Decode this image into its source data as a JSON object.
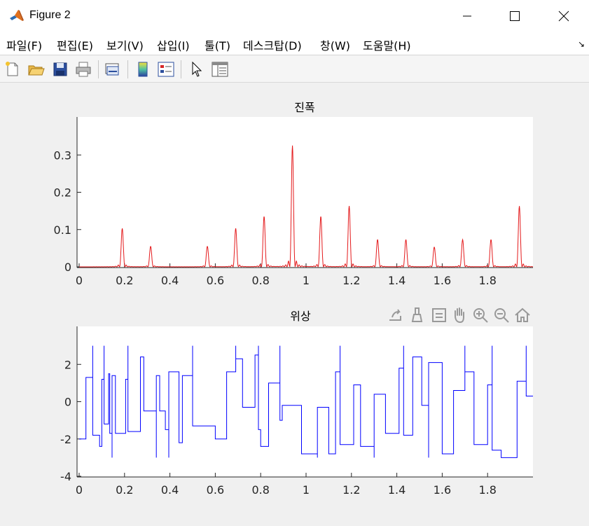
{
  "window": {
    "title": "Figure 2"
  },
  "menu": [
    "파일(F)",
    "편집(E)",
    "보기(V)",
    "삽입(I)",
    "툴(T)",
    "데스크탑(D)",
    "창(W)",
    "도움말(H)"
  ],
  "toolbar_icons": [
    "new-figure-icon",
    "open-file-icon",
    "save-icon",
    "print-icon",
    "link-plot-icon",
    "colorbar-icon",
    "legend-icon",
    "pointer-icon",
    "property-inspector-icon"
  ],
  "axes_toolbar_icons": [
    "export-icon",
    "brush-icon",
    "data-tip-icon",
    "pan-icon",
    "zoom-in-icon",
    "zoom-out-icon",
    "home-icon"
  ],
  "chart_data": [
    {
      "type": "line",
      "title": "진폭",
      "xlabel": "",
      "ylabel": "",
      "xlim": [
        0,
        2
      ],
      "ylim": [
        0,
        0.4
      ],
      "xticks": [
        0,
        0.2,
        0.4,
        0.6,
        0.8,
        1,
        1.2,
        1.4,
        1.6,
        1.8
      ],
      "xtick_labels": [
        "0",
        "0.2",
        "0.4",
        "0.6",
        "0.8",
        "1",
        "1.2",
        "1.4",
        "1.6",
        "1.8"
      ],
      "yticks": [
        0,
        0.1,
        0.2,
        0.3
      ],
      "ytick_labels": [
        "0",
        "0.1",
        "0.2",
        "0.3"
      ],
      "color": "#e41a1c",
      "peaks": [
        {
          "x": 0.19,
          "y": 0.103
        },
        {
          "x": 0.315,
          "y": 0.055
        },
        {
          "x": 0.565,
          "y": 0.055
        },
        {
          "x": 0.69,
          "y": 0.103
        },
        {
          "x": 0.815,
          "y": 0.135
        },
        {
          "x": 0.94,
          "y": 0.325
        },
        {
          "x": 1.065,
          "y": 0.135
        },
        {
          "x": 1.19,
          "y": 0.163
        },
        {
          "x": 1.315,
          "y": 0.073
        },
        {
          "x": 1.44,
          "y": 0.073
        },
        {
          "x": 1.565,
          "y": 0.053
        },
        {
          "x": 1.69,
          "y": 0.073
        },
        {
          "x": 1.815,
          "y": 0.073
        },
        {
          "x": 1.94,
          "y": 0.163
        }
      ]
    },
    {
      "type": "line",
      "title": "위상",
      "xlabel": "",
      "ylabel": "",
      "xlim": [
        0,
        2
      ],
      "ylim": [
        -4,
        4
      ],
      "xticks": [
        0,
        0.2,
        0.4,
        0.6,
        0.8,
        1,
        1.2,
        1.4,
        1.6,
        1.8
      ],
      "xtick_labels": [
        "0",
        "0.2",
        "0.4",
        "0.6",
        "0.8",
        "1",
        "1.2",
        "1.4",
        "1.6",
        "1.8"
      ],
      "yticks": [
        -4,
        -2,
        0,
        2
      ],
      "ytick_labels": [
        "-4",
        "-2",
        "0",
        "2"
      ],
      "color": "#0000ff",
      "levels": [
        {
          "x0": 0.0,
          "x1": 0.03,
          "y": -2.0
        },
        {
          "x0": 0.03,
          "x1": 0.06,
          "y": 1.3
        },
        {
          "x0": 0.06,
          "x1": 0.09,
          "y": -1.8
        },
        {
          "x0": 0.09,
          "x1": 0.1,
          "y": -2.4
        },
        {
          "x0": 0.1,
          "x1": 0.11,
          "y": 1.2
        },
        {
          "x0": 0.11,
          "x1": 0.13,
          "y": -1.2
        },
        {
          "x0": 0.13,
          "x1": 0.135,
          "y": 1.5
        },
        {
          "x0": 0.135,
          "x1": 0.145,
          "y": -1.7
        },
        {
          "x0": 0.145,
          "x1": 0.16,
          "y": 1.4
        },
        {
          "x0": 0.16,
          "x1": 0.205,
          "y": -1.7
        },
        {
          "x0": 0.205,
          "x1": 0.215,
          "y": 1.2
        },
        {
          "x0": 0.215,
          "x1": 0.27,
          "y": -1.6
        },
        {
          "x0": 0.27,
          "x1": 0.285,
          "y": 2.4
        },
        {
          "x0": 0.285,
          "x1": 0.34,
          "y": -0.5
        },
        {
          "x0": 0.34,
          "x1": 0.355,
          "y": 1.4
        },
        {
          "x0": 0.355,
          "x1": 0.38,
          "y": -0.5
        },
        {
          "x0": 0.38,
          "x1": 0.395,
          "y": -1.5
        },
        {
          "x0": 0.395,
          "x1": 0.44,
          "y": 1.6
        },
        {
          "x0": 0.44,
          "x1": 0.455,
          "y": -2.2
        },
        {
          "x0": 0.455,
          "x1": 0.5,
          "y": 1.4
        },
        {
          "x0": 0.5,
          "x1": 0.6,
          "y": -1.3
        },
        {
          "x0": 0.6,
          "x1": 0.65,
          "y": -2.0
        },
        {
          "x0": 0.65,
          "x1": 0.69,
          "y": 1.6
        },
        {
          "x0": 0.69,
          "x1": 0.72,
          "y": 2.3
        },
        {
          "x0": 0.72,
          "x1": 0.775,
          "y": -0.3
        },
        {
          "x0": 0.775,
          "x1": 0.79,
          "y": 2.5
        },
        {
          "x0": 0.79,
          "x1": 0.8,
          "y": -1.5
        },
        {
          "x0": 0.8,
          "x1": 0.835,
          "y": -2.4
        },
        {
          "x0": 0.835,
          "x1": 0.885,
          "y": 1.0
        },
        {
          "x0": 0.885,
          "x1": 0.895,
          "y": -1.0
        },
        {
          "x0": 0.895,
          "x1": 0.98,
          "y": -0.2
        },
        {
          "x0": 0.98,
          "x1": 1.05,
          "y": -2.8
        },
        {
          "x0": 1.05,
          "x1": 1.1,
          "y": -0.3
        },
        {
          "x0": 1.1,
          "x1": 1.13,
          "y": -2.8
        },
        {
          "x0": 1.13,
          "x1": 1.15,
          "y": 1.6
        },
        {
          "x0": 1.15,
          "x1": 1.21,
          "y": -2.3
        },
        {
          "x0": 1.21,
          "x1": 1.24,
          "y": 0.9
        },
        {
          "x0": 1.24,
          "x1": 1.3,
          "y": -2.4
        },
        {
          "x0": 1.3,
          "x1": 1.35,
          "y": 0.4
        },
        {
          "x0": 1.35,
          "x1": 1.41,
          "y": -1.7
        },
        {
          "x0": 1.41,
          "x1": 1.43,
          "y": 1.8
        },
        {
          "x0": 1.43,
          "x1": 1.47,
          "y": -1.8
        },
        {
          "x0": 1.47,
          "x1": 1.51,
          "y": 2.4
        },
        {
          "x0": 1.51,
          "x1": 1.54,
          "y": -0.2
        },
        {
          "x0": 1.54,
          "x1": 1.6,
          "y": 2.1
        },
        {
          "x0": 1.6,
          "x1": 1.65,
          "y": -2.8
        },
        {
          "x0": 1.65,
          "x1": 1.7,
          "y": 0.6
        },
        {
          "x0": 1.7,
          "x1": 1.74,
          "y": 1.6
        },
        {
          "x0": 1.74,
          "x1": 1.8,
          "y": -2.3
        },
        {
          "x0": 1.8,
          "x1": 1.82,
          "y": 0.9
        },
        {
          "x0": 1.82,
          "x1": 1.86,
          "y": -2.6
        },
        {
          "x0": 1.86,
          "x1": 1.93,
          "y": -3.0
        },
        {
          "x0": 1.93,
          "x1": 1.97,
          "y": 1.1
        },
        {
          "x0": 1.97,
          "x1": 2.0,
          "y": 0.3
        }
      ]
    }
  ]
}
